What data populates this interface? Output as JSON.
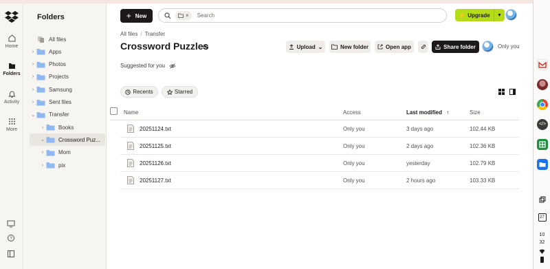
{
  "rail": {
    "items": [
      {
        "label": "Home",
        "icon": "home-icon"
      },
      {
        "label": "Folders",
        "icon": "folder-icon",
        "active": true
      },
      {
        "label": "Activity",
        "icon": "bell-icon"
      },
      {
        "label": "More",
        "icon": "grid-icon"
      }
    ],
    "bottom_icons": [
      "monitor-icon",
      "help-icon",
      "panel-toggle-icon"
    ]
  },
  "panel": {
    "title": "Folders",
    "tree": [
      {
        "label": "All files",
        "indent": 0,
        "chevron": "",
        "icon": "all-files"
      },
      {
        "label": "Apps",
        "indent": 0,
        "chevron": "›"
      },
      {
        "label": "Photos",
        "indent": 0,
        "chevron": "›"
      },
      {
        "label": "Projects",
        "indent": 0,
        "chevron": "›"
      },
      {
        "label": "Samsung",
        "indent": 0,
        "chevron": "›"
      },
      {
        "label": "Sent files",
        "indent": 0,
        "chevron": "›"
      },
      {
        "label": "Transfer",
        "indent": 0,
        "chevron": "⌄"
      },
      {
        "label": "Books",
        "indent": 1,
        "chevron": "›"
      },
      {
        "label": "Crossword Puz...",
        "indent": 1,
        "chevron": "⌄",
        "selected": true
      },
      {
        "label": "Mom",
        "indent": 1,
        "chevron": "›"
      },
      {
        "label": "pix",
        "indent": 1,
        "chevron": "›"
      }
    ]
  },
  "header": {
    "new_label": "New",
    "search_placeholder": "Search",
    "upgrade_label": "Upgrade"
  },
  "breadcrumb": [
    "All files",
    "Transfer"
  ],
  "page_title": "Crossword Puzzles",
  "toolbar": {
    "upload": "Upload",
    "new_folder": "New folder",
    "open_app": "Open app",
    "share_folder": "Share folder",
    "sharing_status": "Only you"
  },
  "suggested_label": "Suggested for you",
  "filters": {
    "recents": "Recents",
    "starred": "Starred"
  },
  "table": {
    "columns": {
      "name": "Name",
      "access": "Access",
      "modified": "Last modified",
      "size": "Size"
    },
    "rows": [
      {
        "name": "20251124.txt",
        "access": "Only you",
        "modified": "3 days ago",
        "size": "102.44 KB"
      },
      {
        "name": "20251125.txt",
        "access": "Only you",
        "modified": "2 days ago",
        "size": "102.36 KB"
      },
      {
        "name": "20251126.txt",
        "access": "Only you",
        "modified": "yesterday",
        "size": "102.79 KB"
      },
      {
        "name": "20251127.txt",
        "access": "Only you",
        "modified": "2 hours ago",
        "size": "103.33 KB"
      }
    ]
  },
  "dock": {
    "apps": [
      "gmail-icon",
      "avatar-icon",
      "chrome-icon",
      "code-icon",
      "sheets-icon",
      "files-icon"
    ],
    "tray": {
      "hour": "10",
      "minute": "32",
      "calendar_day": "27"
    }
  },
  "colors": {
    "accent": "#b4dc19",
    "folder": "#8fb8f0",
    "dark": "#1e1919"
  }
}
